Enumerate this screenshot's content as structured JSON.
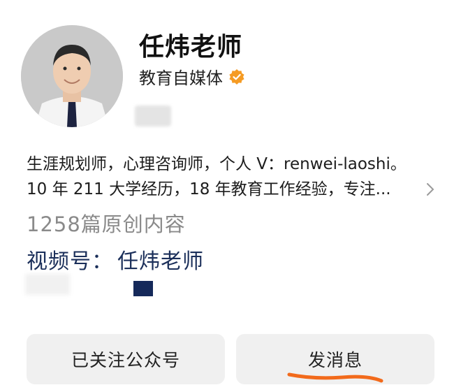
{
  "profile": {
    "name": "任炜老师",
    "role": "教育自媒体",
    "verified_color": "#f59b23"
  },
  "bio": {
    "line1": "生涯规划师，心理咨询师，个人 V：renwei-laoshi。",
    "line2": "10 年 211 大学经历，18 年教育工作经验，专注..."
  },
  "stats": {
    "original_count": "1258篇原创内容"
  },
  "video_channel": {
    "label": "视频号：",
    "name": "任炜老师"
  },
  "actions": {
    "follow_label": "已关注公众号",
    "message_label": "发消息"
  },
  "colors": {
    "accent_link": "#1b2f5a",
    "annotation": "#f26a1b"
  }
}
